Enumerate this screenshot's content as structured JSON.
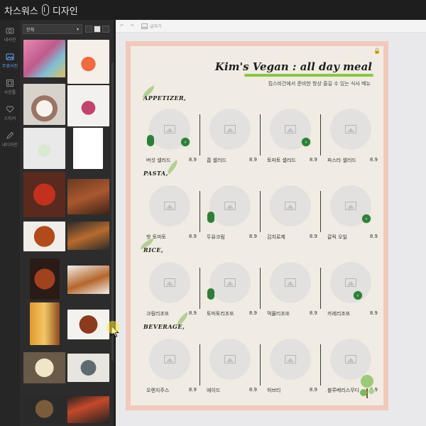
{
  "app": {
    "title_left": "차스워스",
    "title_right": "디자인"
  },
  "rail": [
    {
      "label": "내사진",
      "icon": "camera-icon",
      "active": false
    },
    {
      "label": "무료사진",
      "icon": "gallery-icon",
      "active": true
    },
    {
      "label": "사진틀",
      "icon": "frame-icon",
      "active": false
    },
    {
      "label": "스티커",
      "icon": "heart-icon",
      "active": false
    },
    {
      "label": "내디자인",
      "icon": "pen-icon",
      "active": false
    }
  ],
  "panel": {
    "filter_value": "전체"
  },
  "toolbar": {
    "undo": "↶",
    "redo": "↷",
    "background_label": "글자기"
  },
  "menu": {
    "title": "Kim's Vegan : all day meal",
    "subtitle": "킴스비건에서 준비한 항상 즐길 수 있는 식사 메뉴",
    "sections": [
      {
        "name": "APPETIZER,",
        "items": [
          {
            "name": "버섯 샐러드",
            "price": "8.9"
          },
          {
            "name": "콥 샐러드",
            "price": "8.9"
          },
          {
            "name": "토마토 샐러드",
            "price": "8.9"
          },
          {
            "name": "파스타 샐러드",
            "price": "8.9"
          }
        ]
      },
      {
        "name": "PASTA,",
        "items": [
          {
            "name": "핫 토마토",
            "price": "8.9"
          },
          {
            "name": "두유크림",
            "price": "8.9"
          },
          {
            "name": "김치로제",
            "price": "8.9"
          },
          {
            "name": "갈릭 오일",
            "price": "8.9"
          }
        ]
      },
      {
        "name": "RICE,",
        "items": [
          {
            "name": "크림리조또",
            "price": "8.9"
          },
          {
            "name": "토마토리조또",
            "price": "8.9"
          },
          {
            "name": "먹물리조또",
            "price": "8.9"
          },
          {
            "name": "카레리조또",
            "price": "8.9"
          }
        ]
      },
      {
        "name": "BEVERAGE,",
        "items": [
          {
            "name": "오렌지주스",
            "price": "8.9"
          },
          {
            "name": "에이드",
            "price": "8.9"
          },
          {
            "name": "허브티",
            "price": "8.9"
          },
          {
            "name": "블루베리스무디",
            "price": "8.9"
          }
        ]
      }
    ]
  },
  "colors": {
    "sheet_border": "#f2c9bd",
    "sheet_bg": "#f1ece3",
    "accent_green": "#8cc63f",
    "badge_green": "#2f7d3d"
  }
}
